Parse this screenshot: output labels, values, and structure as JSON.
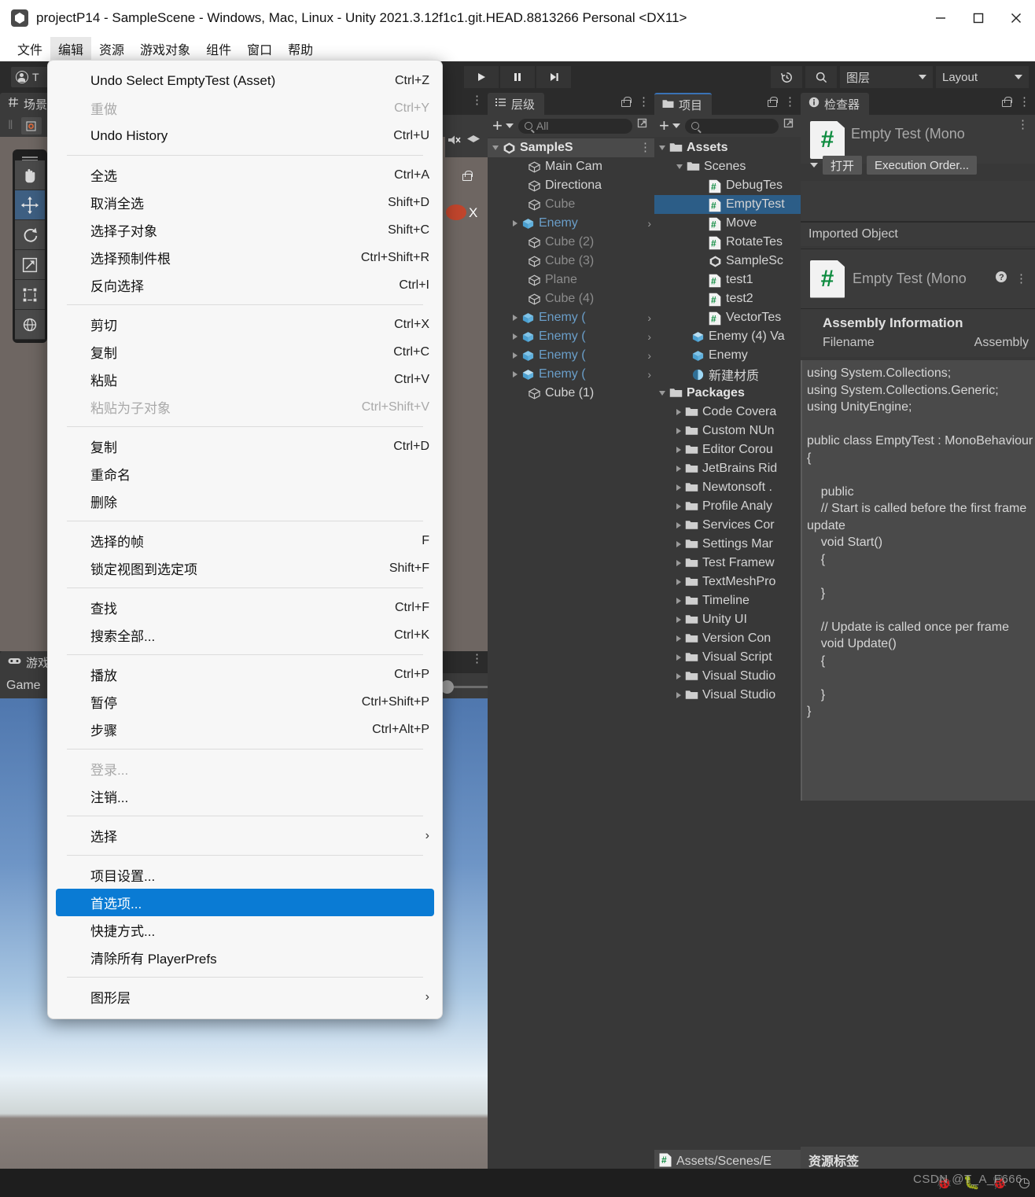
{
  "window": {
    "title": "projectP14 - SampleScene - Windows, Mac, Linux - Unity 2021.3.12f1c1.git.HEAD.8813266 Personal <DX11>",
    "minimize_label": "minimize-icon",
    "maximize_label": "maximize-icon",
    "close_label": "close-icon"
  },
  "menubar": {
    "items": [
      {
        "label": "文件",
        "active": false
      },
      {
        "label": "编辑",
        "active": true
      },
      {
        "label": "资源",
        "active": false
      },
      {
        "label": "游戏对象",
        "active": false
      },
      {
        "label": "组件",
        "active": false
      },
      {
        "label": "窗口",
        "active": false
      },
      {
        "label": "帮助",
        "active": false
      }
    ]
  },
  "toolbar": {
    "account_label": "T",
    "play_label": "play-icon",
    "pause_label": "pause-icon",
    "step_label": "step-icon",
    "history_label": "history-icon",
    "search_label": "search-icon",
    "layers_label": "图层",
    "layout_label": "Layout"
  },
  "edit_menu": {
    "items": [
      {
        "label": "Undo Select EmptyTest (Asset)",
        "shortcut": "Ctrl+Z",
        "state": "normal"
      },
      {
        "label": "重做",
        "shortcut": "Ctrl+Y",
        "state": "disabled"
      },
      {
        "label": "Undo History",
        "shortcut": "Ctrl+U",
        "state": "normal"
      },
      {
        "separator": true
      },
      {
        "label": "全选",
        "shortcut": "Ctrl+A",
        "state": "normal"
      },
      {
        "label": "取消全选",
        "shortcut": "Shift+D",
        "state": "normal"
      },
      {
        "label": "选择子对象",
        "shortcut": "Shift+C",
        "state": "normal"
      },
      {
        "label": "选择预制件根",
        "shortcut": "Ctrl+Shift+R",
        "state": "normal"
      },
      {
        "label": "反向选择",
        "shortcut": "Ctrl+I",
        "state": "normal"
      },
      {
        "separator": true
      },
      {
        "label": "剪切",
        "shortcut": "Ctrl+X",
        "state": "normal"
      },
      {
        "label": "复制",
        "shortcut": "Ctrl+C",
        "state": "normal"
      },
      {
        "label": "粘贴",
        "shortcut": "Ctrl+V",
        "state": "normal"
      },
      {
        "label": "粘贴为子对象",
        "shortcut": "Ctrl+Shift+V",
        "state": "disabled"
      },
      {
        "separator": true
      },
      {
        "label": "复制",
        "shortcut": "Ctrl+D",
        "state": "normal"
      },
      {
        "label": "重命名",
        "shortcut": "",
        "state": "normal"
      },
      {
        "label": "删除",
        "shortcut": "",
        "state": "normal"
      },
      {
        "separator": true
      },
      {
        "label": "选择的帧",
        "shortcut": "F",
        "state": "normal"
      },
      {
        "label": "锁定视图到选定项",
        "shortcut": "Shift+F",
        "state": "normal"
      },
      {
        "separator": true
      },
      {
        "label": "查找",
        "shortcut": "Ctrl+F",
        "state": "normal"
      },
      {
        "label": "搜索全部...",
        "shortcut": "Ctrl+K",
        "state": "normal"
      },
      {
        "separator": true
      },
      {
        "label": "播放",
        "shortcut": "Ctrl+P",
        "state": "normal"
      },
      {
        "label": "暂停",
        "shortcut": "Ctrl+Shift+P",
        "state": "normal"
      },
      {
        "label": "步骤",
        "shortcut": "Ctrl+Alt+P",
        "state": "normal"
      },
      {
        "separator": true
      },
      {
        "label": "登录...",
        "shortcut": "",
        "state": "disabled"
      },
      {
        "label": "注销...",
        "shortcut": "",
        "state": "normal"
      },
      {
        "separator": true
      },
      {
        "label": "选择",
        "shortcut": "",
        "state": "submenu"
      },
      {
        "separator": true
      },
      {
        "label": "项目设置...",
        "shortcut": "",
        "state": "normal"
      },
      {
        "label": "首选项...",
        "shortcut": "",
        "state": "highlight"
      },
      {
        "label": "快捷方式...",
        "shortcut": "",
        "state": "normal"
      },
      {
        "label": "清除所有 PlayerPrefs",
        "shortcut": "",
        "state": "normal"
      },
      {
        "separator": true
      },
      {
        "label": "图形层",
        "shortcut": "",
        "state": "submenu"
      }
    ]
  },
  "scene_panel": {
    "tab_label": "场景",
    "tool_icons": [
      "hand-tool",
      "move-tool",
      "rotate-tool",
      "scale-tool",
      "rect-tool",
      "transform-tool"
    ],
    "active_tool_index": 1
  },
  "game_panel": {
    "tab_label": "游戏",
    "secondary_label": "Game"
  },
  "hierarchy": {
    "tab_label": "层级",
    "search_placeholder": "All",
    "items": [
      {
        "label": "SampleS",
        "indent": 0,
        "arrow": "open",
        "icon": "unity-icon",
        "style": "bold",
        "selected_gray": true
      },
      {
        "label": "Main Cam",
        "indent": 1,
        "arrow": "none",
        "icon": "cube-icon",
        "style": "normal"
      },
      {
        "label": "Directiona",
        "indent": 1,
        "arrow": "none",
        "icon": "cube-icon",
        "style": "normal"
      },
      {
        "label": "Cube",
        "indent": 1,
        "arrow": "none",
        "icon": "cube-icon",
        "style": "dim"
      },
      {
        "label": "Enemy",
        "indent": 1,
        "arrow": "closed",
        "icon": "prefab-icon",
        "style": "blue",
        "chevron": true
      },
      {
        "label": "Cube (2)",
        "indent": 1,
        "arrow": "none",
        "icon": "cube-icon",
        "style": "dim"
      },
      {
        "label": "Cube (3)",
        "indent": 1,
        "arrow": "none",
        "icon": "cube-icon",
        "style": "dim"
      },
      {
        "label": "Plane",
        "indent": 1,
        "arrow": "none",
        "icon": "cube-icon",
        "style": "dim"
      },
      {
        "label": "Cube (4)",
        "indent": 1,
        "arrow": "none",
        "icon": "cube-icon",
        "style": "dim"
      },
      {
        "label": "Enemy (",
        "indent": 1,
        "arrow": "closed",
        "icon": "prefab-icon",
        "style": "blue",
        "chevron": true
      },
      {
        "label": "Enemy (",
        "indent": 1,
        "arrow": "closed",
        "icon": "prefab-icon",
        "style": "blue",
        "chevron": true
      },
      {
        "label": "Enemy (",
        "indent": 1,
        "arrow": "closed",
        "icon": "prefab-icon",
        "style": "blue",
        "chevron": true
      },
      {
        "label": "Enemy (",
        "indent": 1,
        "arrow": "closed",
        "icon": "prefab-variant-icon",
        "style": "blue",
        "chevron": true
      },
      {
        "label": "Cube (1)",
        "indent": 1,
        "arrow": "none",
        "icon": "cube-icon",
        "style": "normal"
      }
    ]
  },
  "project": {
    "tab_label": "项目",
    "search_placeholder": "",
    "items": [
      {
        "label": "Assets",
        "indent": 0,
        "arrow": "open",
        "icon": "folder-icon",
        "style": "bold"
      },
      {
        "label": "Scenes",
        "indent": 1,
        "arrow": "open",
        "icon": "folder-icon",
        "style": "normal"
      },
      {
        "label": "DebugTes",
        "indent": 2,
        "arrow": "none",
        "icon": "cs-icon",
        "style": "normal"
      },
      {
        "label": "EmptyTest",
        "indent": 2,
        "arrow": "none",
        "icon": "cs-icon",
        "style": "normal",
        "selected": true
      },
      {
        "label": "Move",
        "indent": 2,
        "arrow": "none",
        "icon": "cs-icon",
        "style": "normal"
      },
      {
        "label": "RotateTes",
        "indent": 2,
        "arrow": "none",
        "icon": "cs-icon",
        "style": "normal"
      },
      {
        "label": "SampleSc",
        "indent": 2,
        "arrow": "none",
        "icon": "unity-icon",
        "style": "normal"
      },
      {
        "label": "test1",
        "indent": 2,
        "arrow": "none",
        "icon": "cs-icon",
        "style": "normal"
      },
      {
        "label": "test2",
        "indent": 2,
        "arrow": "none",
        "icon": "cs-icon",
        "style": "normal"
      },
      {
        "label": "VectorTes",
        "indent": 2,
        "arrow": "none",
        "icon": "cs-icon",
        "style": "normal"
      },
      {
        "label": "Enemy (4) Va",
        "indent": 1,
        "arrow": "none",
        "icon": "prefab-variant-icon",
        "style": "normal"
      },
      {
        "label": "Enemy",
        "indent": 1,
        "arrow": "none",
        "icon": "prefab-icon",
        "style": "normal"
      },
      {
        "label": "新建材质",
        "indent": 1,
        "arrow": "none",
        "icon": "material-icon",
        "style": "normal"
      },
      {
        "label": "Packages",
        "indent": 0,
        "arrow": "open",
        "icon": "folder-icon",
        "style": "bold"
      },
      {
        "label": "Code Covera",
        "indent": 1,
        "arrow": "closed",
        "icon": "folder-icon",
        "style": "normal"
      },
      {
        "label": "Custom NUn",
        "indent": 1,
        "arrow": "closed",
        "icon": "folder-icon",
        "style": "normal"
      },
      {
        "label": "Editor Corou",
        "indent": 1,
        "arrow": "closed",
        "icon": "folder-icon",
        "style": "normal"
      },
      {
        "label": "JetBrains Rid",
        "indent": 1,
        "arrow": "closed",
        "icon": "folder-icon",
        "style": "normal"
      },
      {
        "label": "Newtonsoft .",
        "indent": 1,
        "arrow": "closed",
        "icon": "folder-icon",
        "style": "normal"
      },
      {
        "label": "Profile Analy",
        "indent": 1,
        "arrow": "closed",
        "icon": "folder-icon",
        "style": "normal"
      },
      {
        "label": "Services Cor",
        "indent": 1,
        "arrow": "closed",
        "icon": "folder-icon",
        "style": "normal"
      },
      {
        "label": "Settings Mar",
        "indent": 1,
        "arrow": "closed",
        "icon": "folder-icon",
        "style": "normal"
      },
      {
        "label": "Test Framew",
        "indent": 1,
        "arrow": "closed",
        "icon": "folder-icon",
        "style": "normal"
      },
      {
        "label": "TextMeshPro",
        "indent": 1,
        "arrow": "closed",
        "icon": "folder-icon",
        "style": "normal"
      },
      {
        "label": "Timeline",
        "indent": 1,
        "arrow": "closed",
        "icon": "folder-icon",
        "style": "normal"
      },
      {
        "label": "Unity UI",
        "indent": 1,
        "arrow": "closed",
        "icon": "folder-icon",
        "style": "normal"
      },
      {
        "label": "Version Con",
        "indent": 1,
        "arrow": "closed",
        "icon": "folder-icon",
        "style": "normal"
      },
      {
        "label": "Visual Script",
        "indent": 1,
        "arrow": "closed",
        "icon": "folder-icon",
        "style": "normal"
      },
      {
        "label": "Visual Studio",
        "indent": 1,
        "arrow": "closed",
        "icon": "folder-icon",
        "style": "normal"
      },
      {
        "label": "Visual Studio",
        "indent": 1,
        "arrow": "closed",
        "icon": "folder-icon",
        "style": "normal"
      }
    ],
    "footer_path": "Assets/Scenes/E"
  },
  "inspector": {
    "tab_label": "检查器",
    "asset_title": "Empty Test (Mono",
    "open_button": "打开",
    "execution_order_button": "Execution Order...",
    "imported_object_label": "Imported Object",
    "component_title": "Empty Test (Mono",
    "assembly_header": "Assembly Information",
    "filename_label": "Filename",
    "filename_value": "Assembly",
    "code": "using System.Collections;\nusing System.Collections.Generic;\nusing UnityEngine;\n\npublic class EmptyTest : MonoBehaviour\n{\n\n    public\n    // Start is called before the first frame update\n    void Start()\n    {\n\n    }\n\n    // Update is called once per frame\n    void Update()\n    {\n\n    }\n}",
    "tags_label": "资源标签"
  },
  "watermark": "CSDN @T_A_F666",
  "colors": {
    "accent_blue": "#0a7bd4",
    "selection_blue": "#2c5d87",
    "panel_bg": "#383838",
    "toolbar_bg": "#2b2b2b",
    "menu_bg": "#f7f7f7"
  }
}
